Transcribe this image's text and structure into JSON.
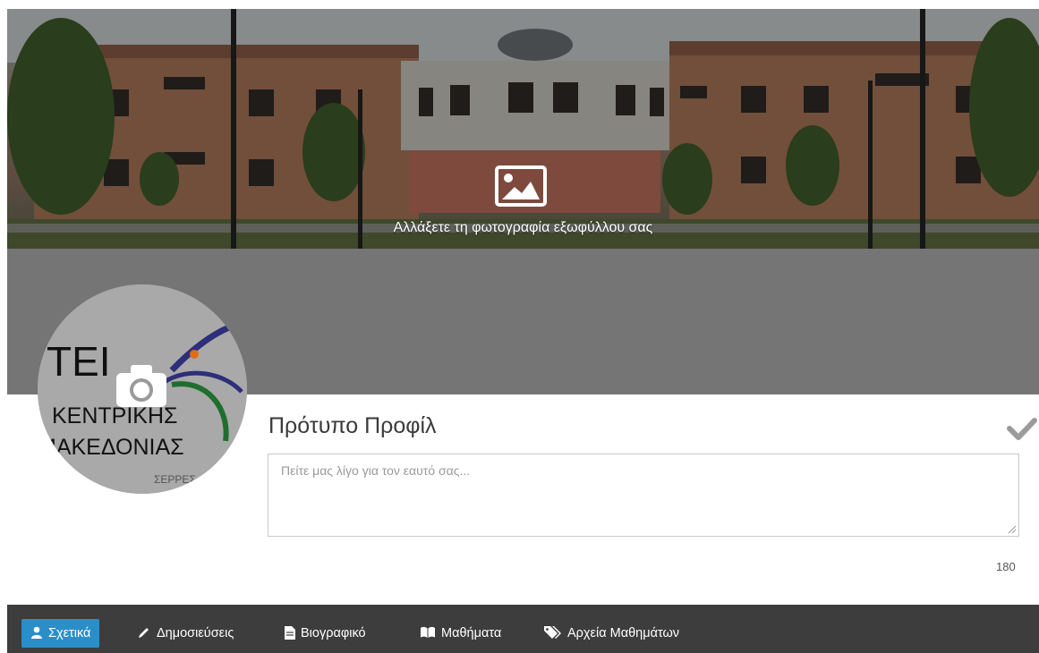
{
  "cover": {
    "caption": "Αλλάξετε τη φωτογραφία εξωφύλλου σας",
    "icon": "image-icon"
  },
  "avatar": {
    "logo_lines": [
      "ΤΕΙ",
      "ΚΕΝΤΡΙΚΗΣ",
      "ΜΑΚΕΔΟΝΙΑΣ",
      "ΣΕΡΡΕΣ"
    ],
    "icon": "camera-icon"
  },
  "profile": {
    "name": "Πρότυπο Προφίλ",
    "bio_placeholder": "Πείτε μας λίγο για τον εαυτό σας...",
    "bio_value": "",
    "char_count": "180",
    "save_icon": "checkmark-icon"
  },
  "nav": {
    "items": [
      {
        "label": "Σχετικά",
        "icon": "user-icon",
        "active": true
      },
      {
        "label": "Δημοσιεύσεις",
        "icon": "pencil-icon",
        "active": false
      },
      {
        "label": "Βιογραφικό",
        "icon": "document-icon",
        "active": false
      },
      {
        "label": "Μαθήματα",
        "icon": "book-icon",
        "active": false
      },
      {
        "label": "Αρχεία Μαθημάτων",
        "icon": "tags-icon",
        "active": false
      }
    ],
    "active_color": "#2a8fc9"
  },
  "colors": {
    "nav_background": "#3d3d3d",
    "gray_band": "#757575"
  }
}
